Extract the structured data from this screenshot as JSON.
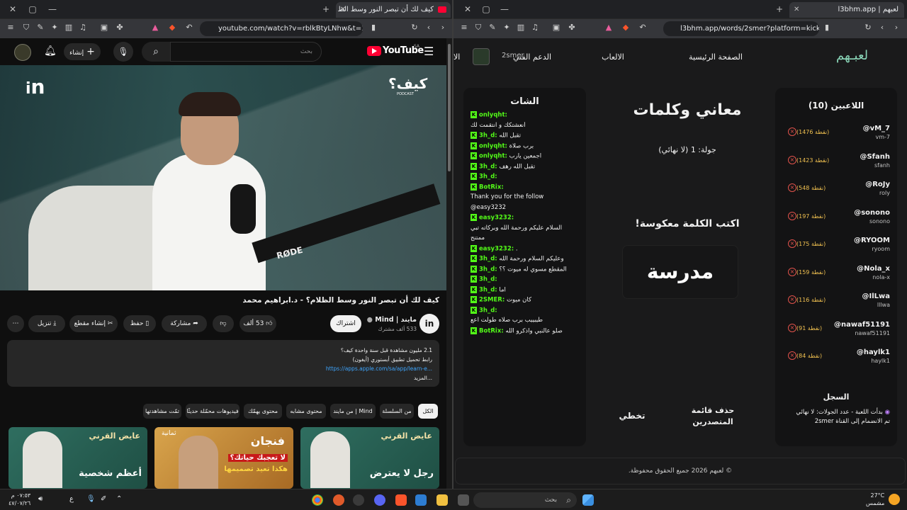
{
  "left_browser": {
    "tab_title": "كيف لك أن تبصر النور وسط الظ",
    "url": "youtube.com/watch?v=rblkBtyLNhw&t=1..."
  },
  "youtube": {
    "logo": "YouTube",
    "logo_region": "SA",
    "search_placeholder": "بحث",
    "create_label": "إنشاء",
    "video_title": "كيف لك أن تبصر النور وسط الظلام؟ - د.ابراهيم محمد",
    "channel_name": "مايند | Mind",
    "subscribers": "533 ألف مشترك",
    "subscribe_label": "اشتراك",
    "likes": "53 ألف",
    "share_label": "مشاركة",
    "save_label": "حفظ",
    "clip_label": "إنشاء مقطع",
    "download_label": "تنزيل",
    "podcast_badge": "كيف؟",
    "podcast_sub": "PODCAST",
    "description": {
      "stats": "2.1 مليون مشاهدة  قبل سنة واحدة  كيف؟",
      "line2": "رابط تحميل تطبيق أبستوري (أيفون)",
      "link": "https://apps.apple.com/sa/app/learn-e...",
      "more": "...المزيد"
    },
    "chips": [
      "الكل",
      "من السلسلة",
      "من مايند | Mind",
      "محتوى مشابه",
      "محتوى يهمّك",
      "فيديوهات محمّلة حديثًا",
      "تمّت مشاهدتها"
    ],
    "thumbnails": [
      {
        "title": "رجل لا يعترض",
        "brand": "عايض القرني"
      },
      {
        "title": "فنجان",
        "subtitle": "لا تعجبك حياتك؟",
        "subtitle2": "هكذا تعيد تصميمها",
        "tag": "ثمانية"
      },
      {
        "title": "أعظم شخصية",
        "brand": "عايض القرني"
      }
    ]
  },
  "right_browser": {
    "tab_title": "لعبهم | l3bhm.app",
    "url": "l3bhm.app/words/2smer?platform=kick"
  },
  "app": {
    "logo": "لعبـهم",
    "nav": [
      "الصفحة الرئيسية",
      "الالعاب",
      "الدعم الفني",
      "الا"
    ],
    "user": "2smer",
    "game_title": "معاني وكلمات",
    "round": "جولة: 1 (لا نهائي)",
    "instruction": "اكتب الكلمة معكوسة!",
    "word": "مدرسة",
    "skip_label": "تخطي",
    "clear_label": "حذف قائمة المتصدرين",
    "players_title": "اللاعبين (10)",
    "players": [
      {
        "name": "@vM_7",
        "handle": "vm-7",
        "points": "(1476 نقطة)"
      },
      {
        "name": "@Sfanh",
        "handle": "sfanh",
        "points": "(1423 نقطة)"
      },
      {
        "name": "@RoJy",
        "handle": "roly",
        "points": "(548 نقطة)"
      },
      {
        "name": "@sonono",
        "handle": "sonono",
        "points": "(197 نقطة)"
      },
      {
        "name": "@RYOOM",
        "handle": "ryoom",
        "points": "(175 نقطة)"
      },
      {
        "name": "@Nola_x",
        "handle": "nola-x",
        "points": "(159 نقطة)"
      },
      {
        "name": "@IlLwa",
        "handle": "lllwa",
        "points": "(116 نقطة)"
      },
      {
        "name": "@nawaf51191",
        "handle": "nawaf51191",
        "points": "(91 نقطة)"
      },
      {
        "name": "@haylk1",
        "handle": "haylk1",
        "points": "(84 نقطة)"
      }
    ],
    "log_title": "السجل",
    "log": [
      "بدأت اللعبة - عدد الجولات: لا نهائي",
      "تم الانضمام إلى القناة 2smer"
    ],
    "chat_title": "الشات",
    "chat": [
      {
        "user": "onlyqht:",
        "msg": ""
      },
      {
        "user": "",
        "msg": "أنعشتكك و انتقمت لك"
      },
      {
        "user": "3h_d:",
        "msg": "تقبل الله"
      },
      {
        "user": "onlyqht:",
        "msg": "برب صلاة"
      },
      {
        "user": "onlyqht:",
        "msg": "اجمعين يارب"
      },
      {
        "user": "3h_d:",
        "msg": "تقبل الله رهف"
      },
      {
        "user": "3h_d:",
        "msg": ""
      },
      {
        "user": "BotRix:",
        "msg": ""
      },
      {
        "user": "",
        "msg": "Thank you for the follow"
      },
      {
        "user": "",
        "msg": "@easy3232"
      },
      {
        "user": "easy3232:",
        "msg": ""
      },
      {
        "user": "",
        "msg": "السلام عليكم ورحمة الله وبركاته تبي"
      },
      {
        "user": "",
        "msg": "ممتنج"
      },
      {
        "user": "easy3232:",
        "msg": "."
      },
      {
        "user": "3h_d:",
        "msg": "وعليكم السلام ورحمة الله"
      },
      {
        "user": "3h_d:",
        "msg": "المقطع مسوي له ميوت ؟؟"
      },
      {
        "user": "3h_d:",
        "msg": ""
      },
      {
        "user": "3h_d:",
        "msg": "اما"
      },
      {
        "user": "2SMER:",
        "msg": "كان ميوت"
      },
      {
        "user": "3h_d:",
        "msg": ""
      },
      {
        "user": "",
        "msg": "طيبييب برب صلاه طولت اعع"
      },
      {
        "user": "BotRix:",
        "msg": "صلو عالنبي واذكرو الله"
      }
    ],
    "footer": "© لعبهم 2026 جميع الحقوق محفوظة."
  },
  "taskbar": {
    "time": "٠٧:٥٣ م",
    "date": "٤٧/٠٧/٢٦",
    "lang": "ع",
    "search_placeholder": "بحث",
    "weather_temp": "27°C",
    "weather_desc": "مشمس"
  }
}
